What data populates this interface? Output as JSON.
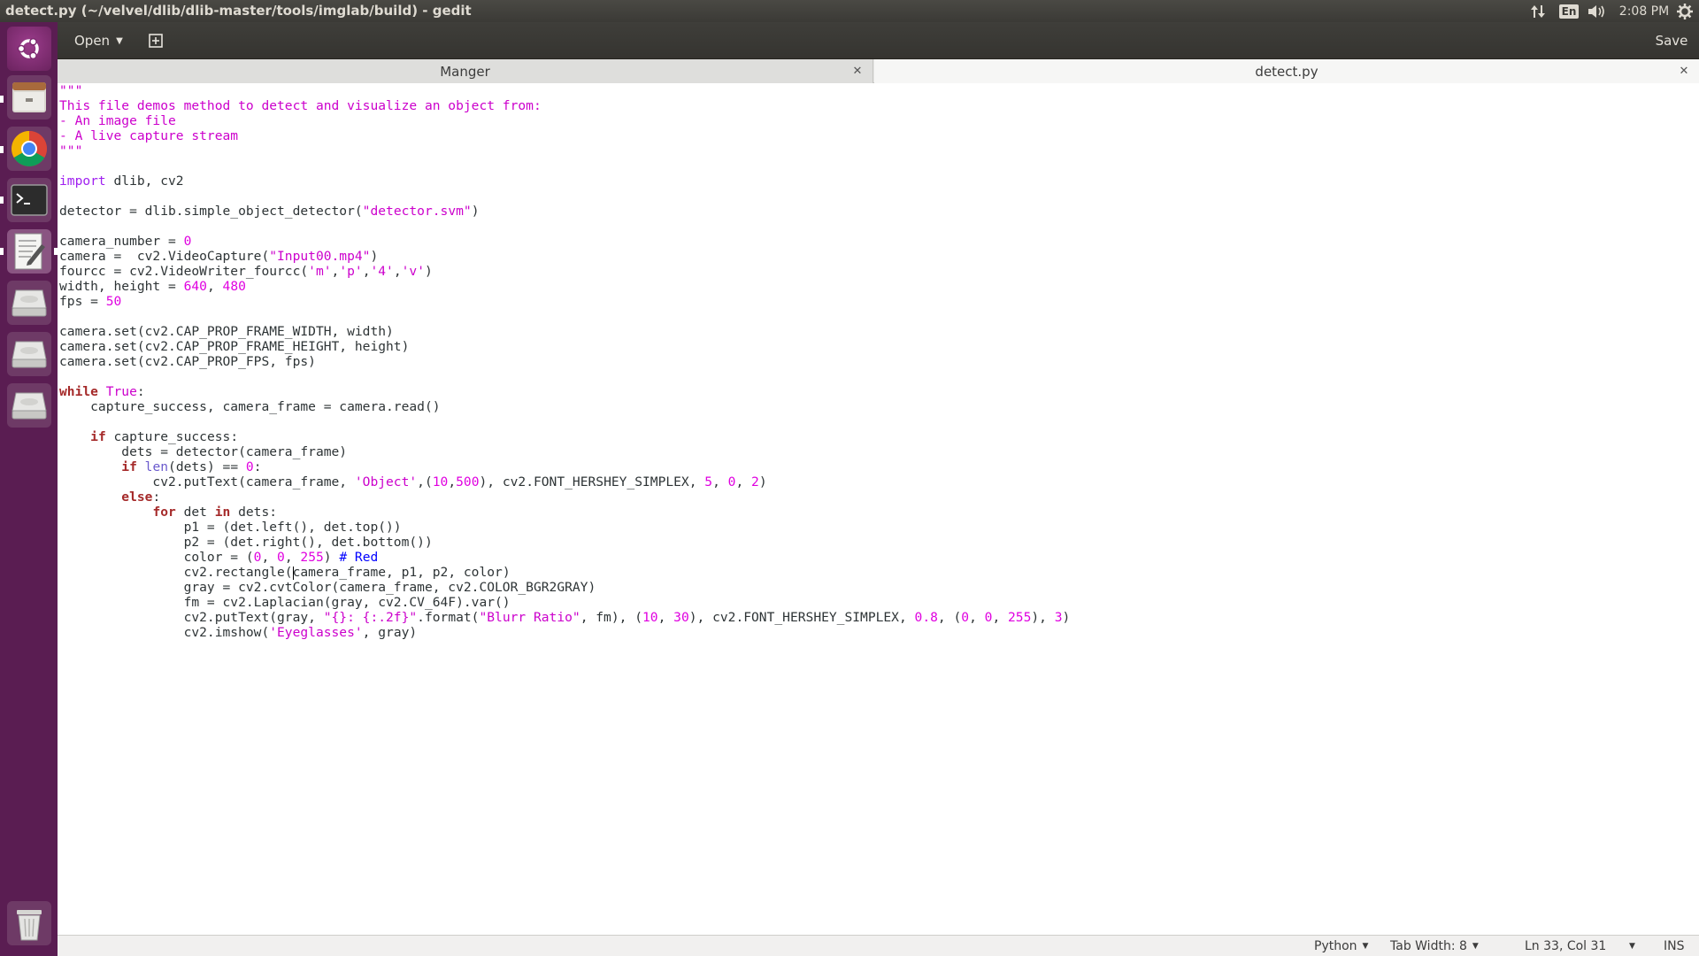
{
  "window": {
    "title": "detect.py (~/velvel/dlib/dlib-master/tools/imglab/build) - gedit"
  },
  "top_panel": {
    "keyboard_layout": "En",
    "clock": "2:08 PM",
    "icons": [
      "network-updown-icon",
      "keyboard-layout-icon",
      "volume-icon",
      "settings-gear-icon"
    ]
  },
  "launcher": {
    "items": [
      "ubuntu-logo-icon",
      "files-icon",
      "chrome-icon",
      "terminal-icon",
      "text-editor-icon",
      "drive-icon",
      "drive-icon",
      "drive-icon",
      "trash-icon"
    ],
    "background": "#5a1d52"
  },
  "toolbar": {
    "open_label": "Open",
    "save_label": "Save"
  },
  "tabs": [
    {
      "label": "Manger",
      "active": false
    },
    {
      "label": "detect.py",
      "active": true
    }
  ],
  "code": {
    "lines": [
      "\"\"\"",
      "This file demos method to detect and visualize an object from:",
      "- An image file",
      "- A live capture stream",
      "\"\"\"",
      "",
      "import dlib, cv2",
      "",
      "detector = dlib.simple_object_detector(\"detector.svm\")",
      "",
      "camera_number = 0",
      "camera =  cv2.VideoCapture(\"Input00.mp4\")",
      "fourcc = cv2.VideoWriter_fourcc('m','p','4','v')",
      "width, height = 640, 480",
      "fps = 50",
      "",
      "camera.set(cv2.CAP_PROP_FRAME_WIDTH, width)",
      "camera.set(cv2.CAP_PROP_FRAME_HEIGHT, height)",
      "camera.set(cv2.CAP_PROP_FPS, fps)",
      "",
      "while True:",
      "    capture_success, camera_frame = camera.read()",
      "",
      "    if capture_success:",
      "        dets = detector(camera_frame)",
      "        if len(dets) == 0:",
      "            cv2.putText(camera_frame, 'Object',(10,500), cv2.FONT_HERSHEY_SIMPLEX, 5, 0, 2)",
      "        else:",
      "            for det in dets:",
      "                p1 = (det.left(), det.top())",
      "                p2 = (det.right(), det.bottom())",
      "                color = (0, 0, 255) # Red",
      "                cv2.rectangle(camera_frame, p1, p2, color)",
      "                gray = cv2.cvtColor(camera_frame, cv2.COLOR_BGR2GRAY)",
      "                fm = cv2.Laplacian(gray, cv2.CV_64F).var()",
      "                cv2.putText(gray, \"{}: {:.2f}\".format(\"Blurr Ratio\", fm), (10, 30), cv2.FONT_HERSHEY_SIMPLEX, 0.8, (0, 0, 255), 3)",
      "                cv2.imshow('Eyeglasses', gray)"
    ]
  },
  "statusbar": {
    "language": "Python",
    "tab_width": "Tab Width: 8",
    "position": "Ln 33, Col 31",
    "mode": "INS"
  },
  "colors": {
    "string": "#cc00cc",
    "number": "#e000e0",
    "keyword": "#a52a2a",
    "import": "#a020f0",
    "builtin": "#6a5acd",
    "comment": "#0000ff"
  }
}
